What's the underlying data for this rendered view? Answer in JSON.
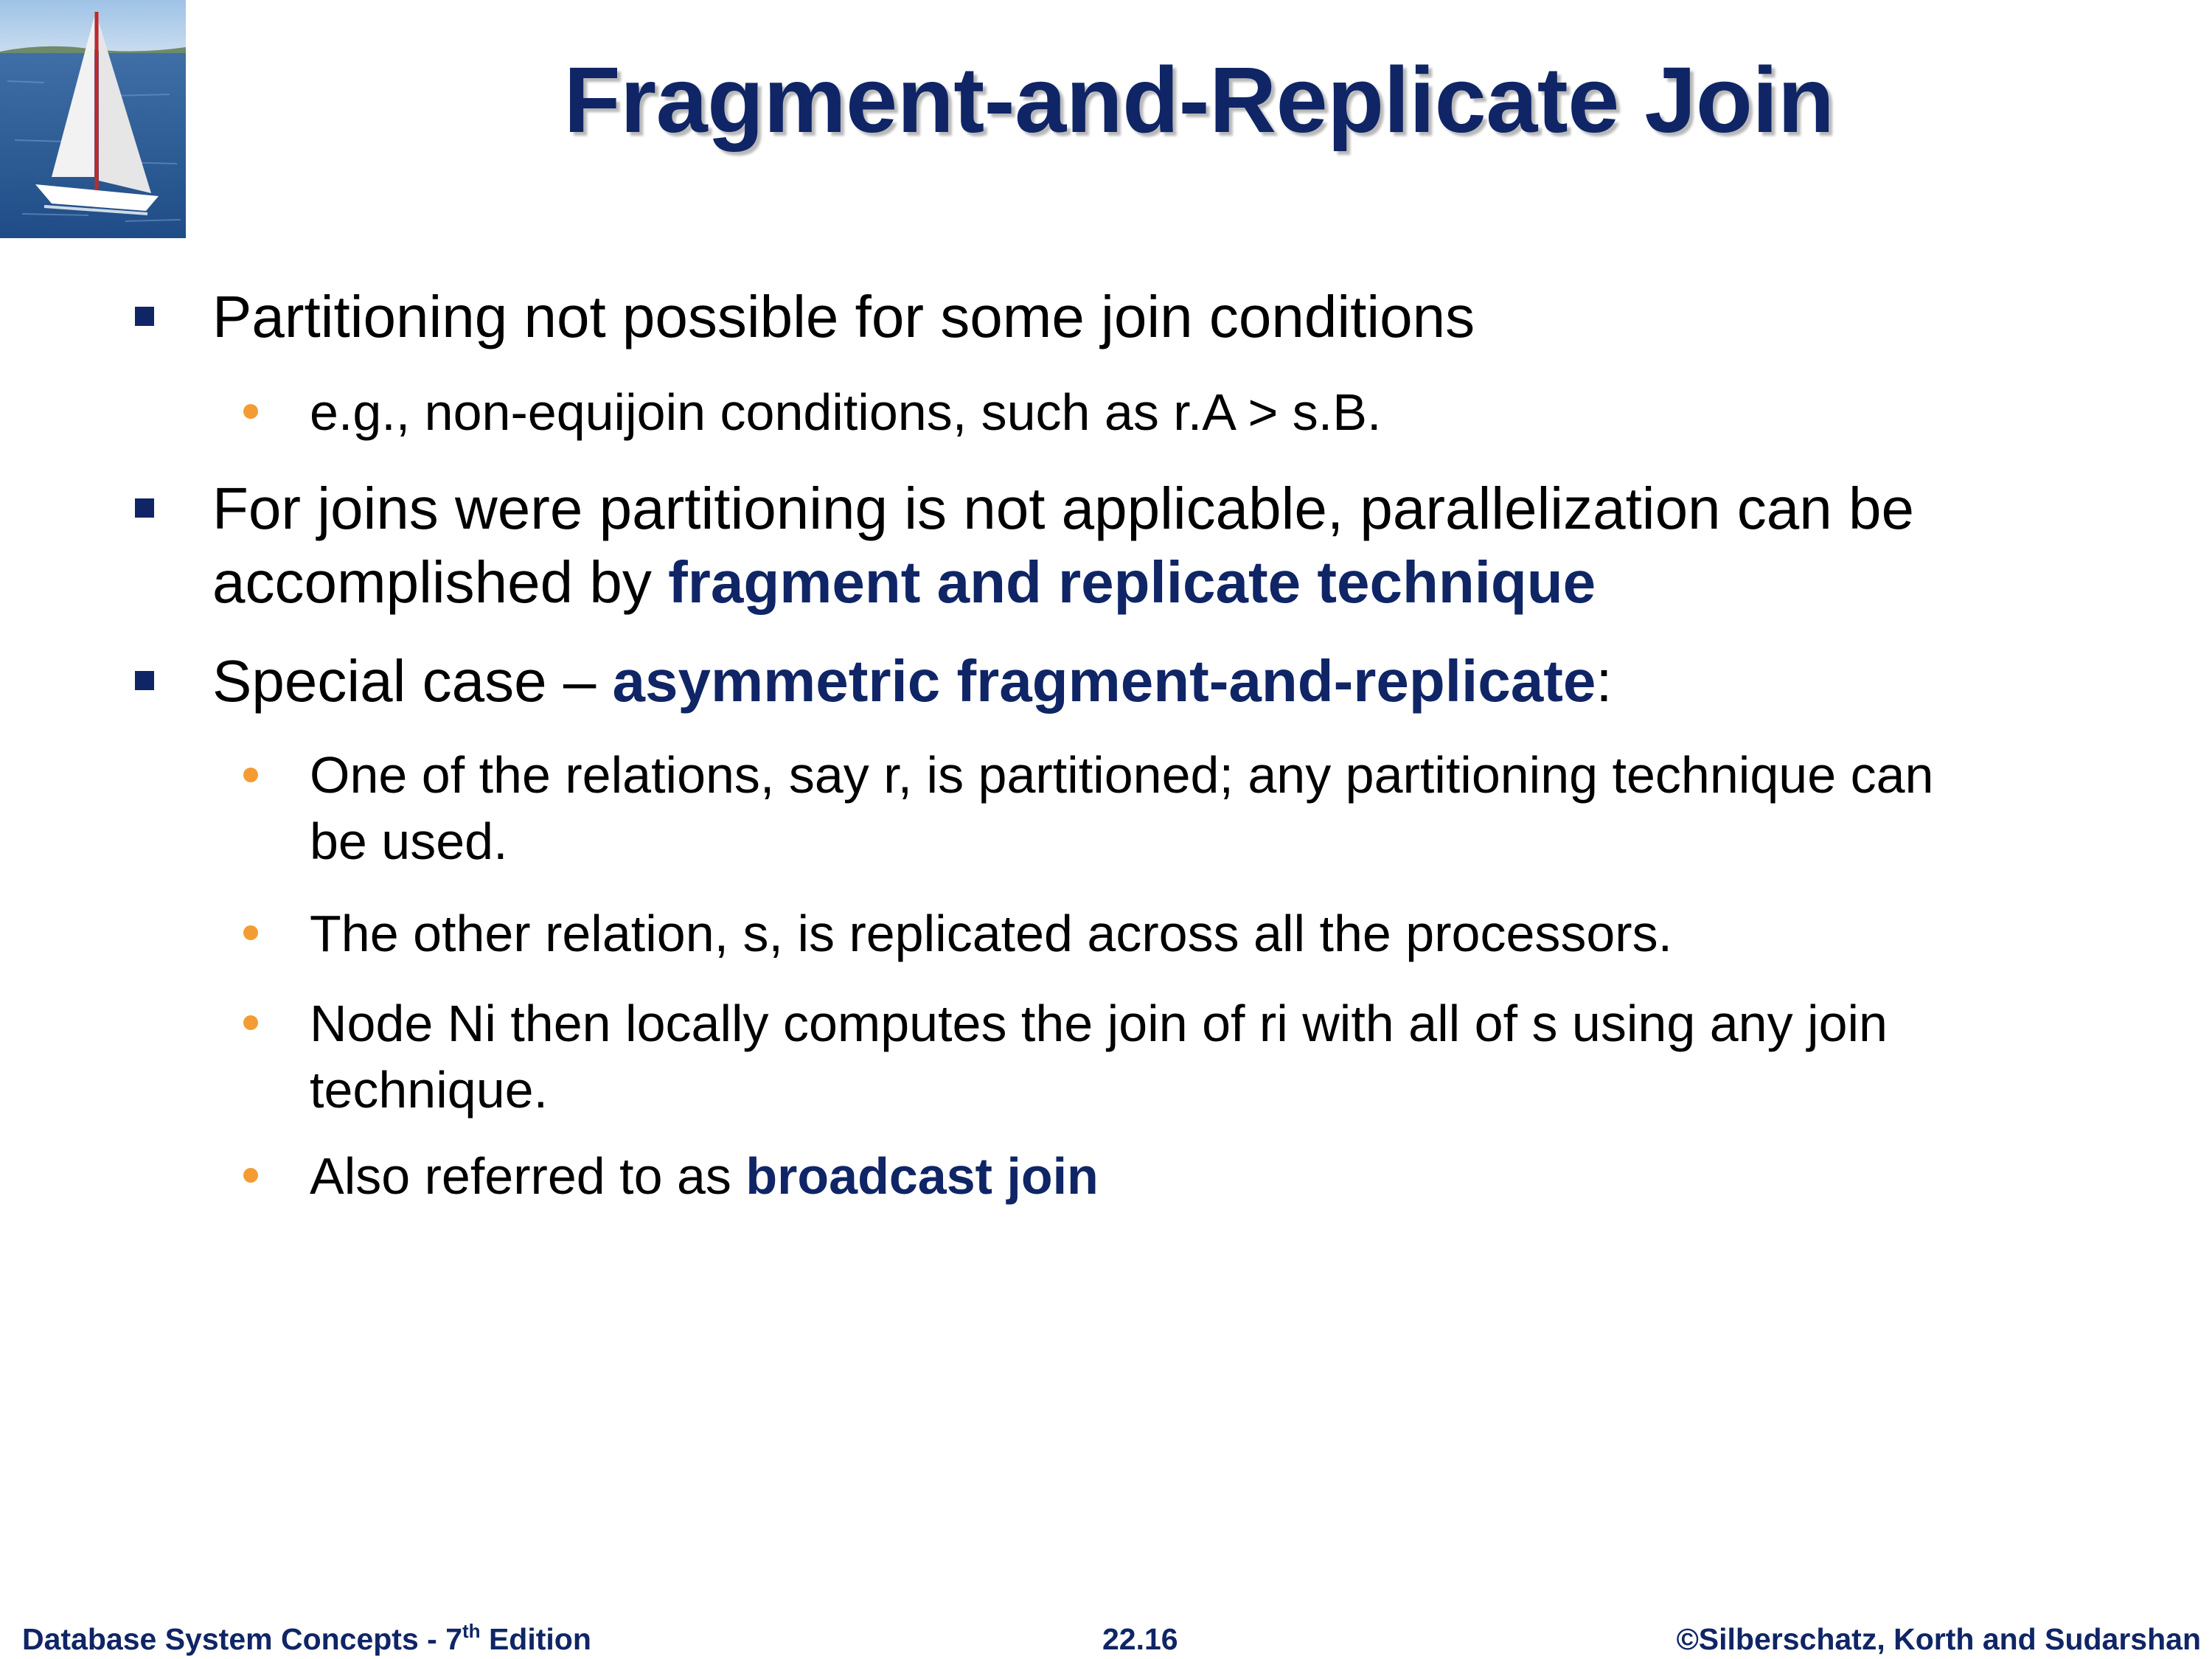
{
  "slide": {
    "title": "Fragment-and-Replicate Join"
  },
  "bullets": {
    "b1": {
      "text": "Partitioning not possible for some join conditions"
    },
    "b1_1": {
      "text": "e.g., non-equijoin conditions, such as r.A > s.B."
    },
    "b2": {
      "line1": "For joins were partitioning is not applicable, parallelization  can be",
      "line2_prefix": "accomplished by ",
      "line2_highlight": "fragment and replicate technique"
    },
    "b3": {
      "prefix": "Special case – ",
      "highlight": "asymmetric fragment-and-replicate",
      "suffix": ":"
    },
    "b3_1": {
      "line1": "One of the relations, say r, is partitioned; any partitioning technique can",
      "line2": "be used."
    },
    "b3_2": {
      "text": "The other relation, s, is replicated across all the processors."
    },
    "b3_3": {
      "line1": "Node Ni then locally computes the join of ri with all of s using any join",
      "line2": "technique."
    },
    "b3_4": {
      "prefix": "Also referred to as ",
      "highlight": "broadcast join"
    }
  },
  "footer": {
    "left_main": "Database System Concepts - 7",
    "left_sup": "th",
    "left_tail": " Edition",
    "center": "22.16",
    "right": "©Silberschatz, Korth and Sudarshan"
  },
  "colors": {
    "title": "#0f2566",
    "highlight": "#0f2566",
    "level1_bullet": "#0f2566",
    "level2_bullet": "#f39c34",
    "footer": "#0f2566"
  },
  "icons": {
    "logo": "sailboat-photo",
    "level1_bullet": "square-bullet",
    "level2_bullet": "dot-bullet"
  }
}
